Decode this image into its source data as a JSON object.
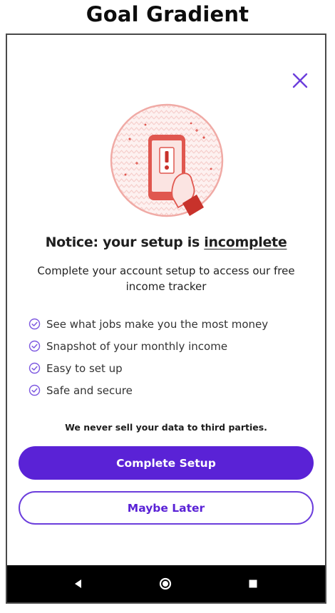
{
  "caption": "Goal Gradient",
  "colors": {
    "accent": "#5a22d6",
    "accent_light": "#7d58e0",
    "illustration_pink": "#f2b8b4",
    "illustration_red": "#e0574f"
  },
  "modal": {
    "close_icon": "close-icon",
    "illustration": "phone-alert-illustration",
    "headline_prefix": "Notice: your setup is ",
    "headline_emphasis": "incomplete",
    "subtext": "Complete your account setup to access our free income tracker",
    "benefits": [
      "See what jobs make you the most money",
      "Snapshot of your monthly income",
      "Easy to set up",
      "Safe and secure"
    ],
    "privacy_note": "We never sell your data to third parties.",
    "primary_button": "Complete Setup",
    "secondary_button": "Maybe Later"
  },
  "nav_bar": {
    "items": [
      "back-icon",
      "home-icon",
      "recents-icon"
    ]
  }
}
